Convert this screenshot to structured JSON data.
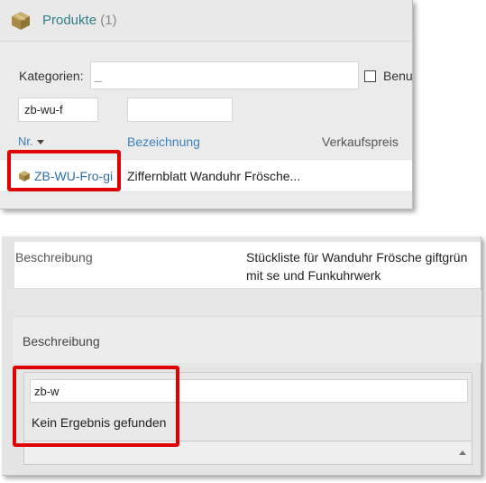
{
  "products_panel": {
    "title": "Produkte",
    "count": "(1)",
    "categories_label": "Kategorien:",
    "categories_value": "_",
    "checkbox_label": "Benu",
    "filter_nr_value": "zb-wu-f",
    "filter_bez_value": "",
    "columns": {
      "nr": "Nr.",
      "bezeichnung": "Bezeichnung",
      "verkaufspreis": "Verkaufspreis"
    },
    "rows": [
      {
        "nr": "ZB-WU-Fro-gi",
        "bezeichnung": "Ziffernblatt Wanduhr Frösche..."
      }
    ]
  },
  "detail_panel": {
    "description_label": "Beschreibung",
    "description_value": "Stückliste für Wanduhr Frösche giftgrün mit se und Funkuhrwerk",
    "section_label": "Beschreibung",
    "search_value": "zb-w",
    "no_result": "Kein Ergebnis gefunden"
  },
  "colors": {
    "highlight": "#e00000",
    "link": "#3a7fbd",
    "title": "#2f7e87",
    "box_icon": "#b59a57"
  },
  "icons": {
    "product": "package-box-icon",
    "sort": "caret-down-icon",
    "select": "caret-up-icon"
  }
}
